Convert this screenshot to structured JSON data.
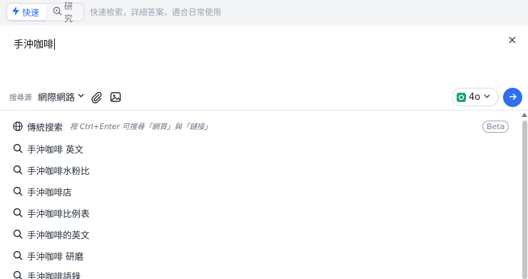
{
  "topbar": {
    "modes": [
      {
        "label": "快速",
        "icon": "lightning-icon",
        "active": true
      },
      {
        "label": "研究",
        "icon": "research-search-icon",
        "active": false
      }
    ],
    "hint": "快速檢索，詳細答案，適合日常使用"
  },
  "query": {
    "value": "手沖咖啡"
  },
  "source": {
    "label": "搜尋源",
    "selected": "網際網路"
  },
  "model": {
    "name": "4o"
  },
  "colors": {
    "accent": "#2f6fed",
    "model_logo": "#19a66c"
  },
  "suggestions": {
    "traditional": {
      "label": "傳統搜索",
      "hint": "按 Ctrl+Enter 可搜尋「網頁」與「鏈接」",
      "badge": "Beta"
    },
    "items": [
      "手沖咖啡 英文",
      "手沖咖啡水粉比",
      "手沖咖啡店",
      "手沖咖啡比例表",
      "手沖咖啡的英文",
      "手沖咖啡 研磨",
      "手沖咖啡語錄"
    ]
  }
}
